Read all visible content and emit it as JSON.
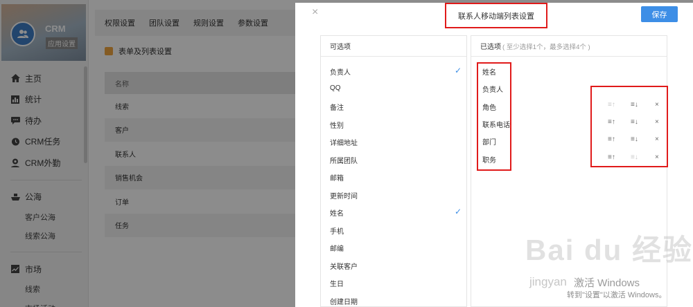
{
  "sidebar": {
    "brand_title": "CRM",
    "brand_subtitle": "应用设置",
    "items": [
      {
        "label": "主页",
        "icon": "home-icon"
      },
      {
        "label": "统计",
        "icon": "chart-icon"
      },
      {
        "label": "待办",
        "icon": "chat-icon"
      },
      {
        "label": "CRM任务",
        "icon": "clock-icon"
      },
      {
        "label": "CRM外勤",
        "icon": "location-icon"
      }
    ],
    "group1": {
      "label": "公海",
      "subitems": [
        "客户公海",
        "线索公海"
      ]
    },
    "group2": {
      "label": "市场",
      "subitems": [
        "线索",
        "市场活动"
      ]
    }
  },
  "topnav": [
    "权限设置",
    "团队设置",
    "规则设置",
    "参数设置"
  ],
  "section_title": "表单及列表设置",
  "bg_table": {
    "header": "名称",
    "rows": [
      "线索",
      "客户",
      "联系人",
      "销售机会",
      "订单",
      "任务"
    ]
  },
  "modal": {
    "close": "×",
    "title": "联系人移动端列表设置",
    "save": "保存",
    "available": {
      "header": "可选项",
      "items": [
        "负责人",
        "QQ",
        "备注",
        "性别",
        "详细地址",
        "所属团队",
        "邮箱",
        "更新时间",
        "姓名",
        "手机",
        "邮编",
        "关联客户",
        "生日",
        "创建日期"
      ],
      "checked": [
        true,
        false,
        false,
        false,
        false,
        false,
        false,
        false,
        true,
        false,
        false,
        false,
        false,
        false
      ]
    },
    "selected": {
      "header": "已选项",
      "hint": "( 至少选择1个，最多选择4个 )",
      "items": [
        "姓名",
        "负责人",
        "角色",
        "联系电话",
        "部门",
        "职务"
      ],
      "action_up": "≡↑",
      "action_down": "≡↓",
      "action_remove": "×"
    }
  },
  "watermark": {
    "brand": "Bai du 经验",
    "site": "jingyan",
    "activate": "激活 Windows",
    "activate_hint": "转到\"设置\"以激活 Windows。"
  },
  "colors": {
    "accent": "#3d8ee6",
    "highlight": "#e01a1a"
  }
}
